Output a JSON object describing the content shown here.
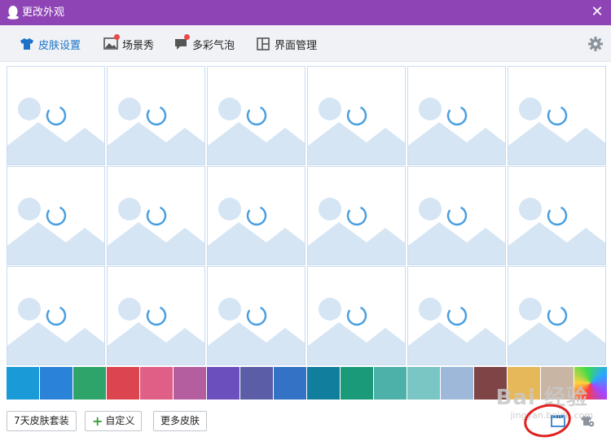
{
  "window": {
    "title": "更改外观",
    "close_glyph": "✕"
  },
  "tabs": [
    {
      "label": "皮肤设置",
      "icon": "tshirt-icon",
      "active": true,
      "badge": false
    },
    {
      "label": "场景秀",
      "icon": "picture-icon",
      "active": false,
      "badge": true
    },
    {
      "label": "多彩气泡",
      "icon": "speech-bubble-icon",
      "active": false,
      "badge": true
    },
    {
      "label": "界面管理",
      "icon": "layout-icon",
      "active": false,
      "badge": false
    }
  ],
  "grid": {
    "rows": 3,
    "columns": 6,
    "state": "loading"
  },
  "swatches": [
    "#1a9ad6",
    "#2b83d9",
    "#2ea46a",
    "#dc4450",
    "#e05f86",
    "#b45e9f",
    "#6a4fbd",
    "#5b5ea6",
    "#3372c5",
    "#107e9c",
    "#1a9a79",
    "#4db1a9",
    "#7ac6c4",
    "#9db8d8",
    "#7f4446",
    "#e7b85a",
    "#c9b5a4",
    "rainbow"
  ],
  "buttons": {
    "suit": "7天皮肤套装",
    "custom": "自定义",
    "more": "更多皮肤"
  },
  "watermark": {
    "main": "Bai 经验",
    "sub": "jingyan.baidu.com"
  },
  "colors": {
    "titlebar": "#8e44b5",
    "accent": "#1a73c8",
    "placeholder": "#d5e5f4",
    "spinner": "#4a9fe0",
    "annotation": "#e02020"
  }
}
